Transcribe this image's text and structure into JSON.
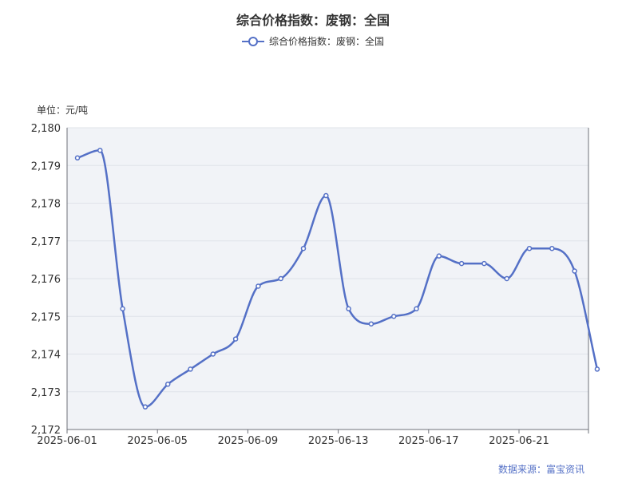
{
  "chart_data": {
    "type": "line",
    "title": "综合价格指数：废钢：全国",
    "unit_label": "单位：元/吨",
    "source": "数据来源：富宝资讯",
    "series": [
      {
        "name": "综合价格指数：废钢：全国",
        "color": "#5470c6",
        "x": [
          "2025-06-01",
          "2025-06-02",
          "2025-06-03",
          "2025-06-04",
          "2025-06-05",
          "2025-06-06",
          "2025-06-07",
          "2025-06-08",
          "2025-06-09",
          "2025-06-10",
          "2025-06-11",
          "2025-06-12",
          "2025-06-13",
          "2025-06-14",
          "2025-06-15",
          "2025-06-16",
          "2025-06-17",
          "2025-06-18",
          "2025-06-19",
          "2025-06-20",
          "2025-06-21",
          "2025-06-22",
          "2025-06-23",
          "2025-06-24"
        ],
        "values": [
          2179.2,
          2179.4,
          2175.2,
          2172.6,
          2173.2,
          2173.6,
          2174.0,
          2174.4,
          2175.8,
          2176.0,
          2176.8,
          2178.2,
          2175.2,
          2174.8,
          2175.0,
          2175.2,
          2176.6,
          2176.4,
          2176.4,
          2176.0,
          2176.8,
          2176.8,
          2176.2,
          2173.6
        ]
      }
    ],
    "x_tick_labels": [
      "2025-06-01",
      "2025-06-05",
      "2025-06-09",
      "2025-06-13",
      "2025-06-17",
      "2025-06-21"
    ],
    "y_tick_labels": [
      "2,172",
      "2,173",
      "2,174",
      "2,175",
      "2,176",
      "2,177",
      "2,178",
      "2,179",
      "2,180"
    ],
    "ylim": [
      2172,
      2180
    ],
    "grid": true,
    "legend_position": "top-center",
    "plot_background": "#f1f3f7"
  }
}
